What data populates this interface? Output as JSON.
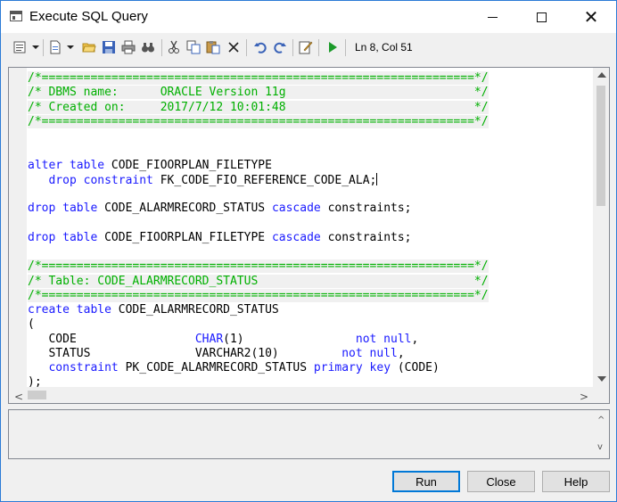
{
  "window": {
    "title": "Execute SQL Query"
  },
  "toolbar": {
    "status": "Ln 8, Col 51",
    "icons": [
      "properties-icon",
      "new-document-icon",
      "open-folder-icon",
      "save-icon",
      "print-icon",
      "find-icon",
      "cut-icon",
      "copy-icon",
      "paste-icon",
      "delete-icon",
      "undo-icon",
      "redo-icon",
      "edit-icon",
      "run-icon"
    ]
  },
  "editor": {
    "lines": [
      {
        "parts": [
          {
            "t": "/*==============================================================*/",
            "c": "comment"
          }
        ]
      },
      {
        "parts": [
          {
            "t": "/* DBMS name:      ORACLE Version 11g                           */",
            "c": "comment"
          }
        ]
      },
      {
        "parts": [
          {
            "t": "/* Created on:     2017/7/12 10:01:48                           */",
            "c": "comment"
          }
        ]
      },
      {
        "parts": [
          {
            "t": "/*==============================================================*/",
            "c": "comment"
          }
        ]
      },
      {
        "parts": []
      },
      {
        "parts": []
      },
      {
        "parts": [
          {
            "t": "alter table",
            "c": "kw"
          },
          {
            "t": " CODE_FIOORPLAN_FILETYPE",
            "c": ""
          }
        ]
      },
      {
        "parts": [
          {
            "t": "   ",
            "c": ""
          },
          {
            "t": "drop constraint",
            "c": "kw"
          },
          {
            "t": " FK_CODE_FIO_REFERENCE_CODE_ALA;",
            "c": ""
          },
          {
            "t": "",
            "c": "caret"
          }
        ]
      },
      {
        "parts": []
      },
      {
        "parts": [
          {
            "t": "drop table",
            "c": "kw"
          },
          {
            "t": " CODE_ALARMRECORD_STATUS ",
            "c": ""
          },
          {
            "t": "cascade",
            "c": "kw"
          },
          {
            "t": " constraints;",
            "c": ""
          }
        ]
      },
      {
        "parts": []
      },
      {
        "parts": [
          {
            "t": "drop table",
            "c": "kw"
          },
          {
            "t": " CODE_FIOORPLAN_FILETYPE ",
            "c": ""
          },
          {
            "t": "cascade",
            "c": "kw"
          },
          {
            "t": " constraints;",
            "c": ""
          }
        ]
      },
      {
        "parts": []
      },
      {
        "parts": [
          {
            "t": "/*==============================================================*/",
            "c": "comment"
          }
        ]
      },
      {
        "parts": [
          {
            "t": "/* Table: CODE_ALARMRECORD_STATUS                               */",
            "c": "comment"
          }
        ]
      },
      {
        "parts": [
          {
            "t": "/*==============================================================*/",
            "c": "comment"
          }
        ]
      },
      {
        "parts": [
          {
            "t": "create table",
            "c": "kw"
          },
          {
            "t": " CODE_ALARMRECORD_STATUS",
            "c": ""
          }
        ]
      },
      {
        "parts": [
          {
            "t": "(",
            "c": ""
          }
        ]
      },
      {
        "parts": [
          {
            "t": "   CODE                 ",
            "c": ""
          },
          {
            "t": "CHAR",
            "c": "kw"
          },
          {
            "t": "(1)                ",
            "c": ""
          },
          {
            "t": "not null",
            "c": "kw"
          },
          {
            "t": ",",
            "c": ""
          }
        ]
      },
      {
        "parts": [
          {
            "t": "   STATUS               VARCHAR2(10)         ",
            "c": ""
          },
          {
            "t": "not null",
            "c": "kw"
          },
          {
            "t": ",",
            "c": ""
          }
        ]
      },
      {
        "parts": [
          {
            "t": "   ",
            "c": ""
          },
          {
            "t": "constraint",
            "c": "kw"
          },
          {
            "t": " PK_CODE_ALARMRECORD_STATUS ",
            "c": ""
          },
          {
            "t": "primary key",
            "c": "kw"
          },
          {
            "t": " (CODE)",
            "c": ""
          }
        ]
      },
      {
        "parts": [
          {
            "t": ");",
            "c": ""
          }
        ]
      }
    ]
  },
  "buttons": {
    "run": "Run",
    "close": "Close",
    "help": "Help"
  },
  "colors": {
    "comment": "#00b000",
    "keyword": "#1a1aff",
    "accent": "#0078d7"
  }
}
